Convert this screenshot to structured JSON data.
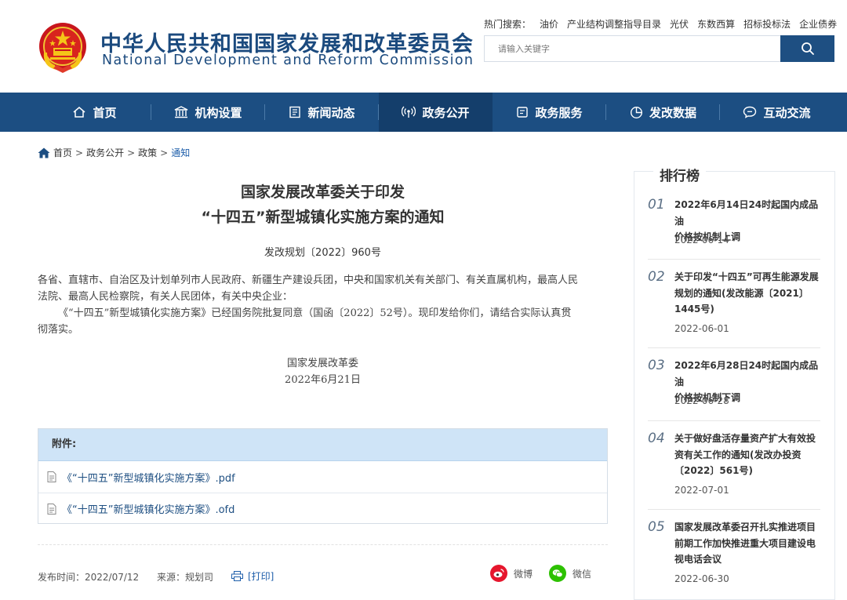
{
  "header": {
    "title_cn": "中华人民共和国国家发展和改革委员会",
    "title_en": "National Development and Reform Commission",
    "hot_label": "热门搜索：",
    "hot_items": [
      "油价",
      "产业结构调整指导目录",
      "光伏",
      "东数西算",
      "招标投标法",
      "企业债券"
    ],
    "search_placeholder": "请输入关键字"
  },
  "nav": {
    "items": [
      {
        "label": "首页",
        "icon": "home-icon"
      },
      {
        "label": "机构设置",
        "icon": "institution-icon"
      },
      {
        "label": "新闻动态",
        "icon": "news-icon"
      },
      {
        "label": "政务公开",
        "icon": "broadcast-icon",
        "active": true
      },
      {
        "label": "政务服务",
        "icon": "service-icon"
      },
      {
        "label": "发改数据",
        "icon": "pie-chart-icon"
      },
      {
        "label": "互动交流",
        "icon": "chat-icon"
      }
    ]
  },
  "breadcrumb": {
    "items": [
      "首页",
      "政务公开",
      "政策"
    ],
    "current": "通知",
    "separator": ">"
  },
  "article": {
    "title_line1": "国家发展改革委关于印发",
    "title_line2": "“十四五”新型城镇化实施方案的通知",
    "doc_no": "发改规划〔2022〕960号",
    "para1_line1": "各省、直辖市、自治区及计划单列市人民政府、新疆生产建设兵团，中央和国家机关有关部门、有关直属机构，最高人民",
    "para1_line2": "法院、最高人民检察院，有关人民团体，有关中央企业：",
    "para2_line1": "《“十四五”新型城镇化实施方案》已经国务院批复同意（国函〔2022〕52号）。现印发给你们，请结合实际认真贯",
    "para2_line2": "彻落实。",
    "signer": "国家发展改革委",
    "sign_date": "2022年6月21日"
  },
  "attachments": {
    "heading": "附件:",
    "files": [
      "《“十四五”新型城镇化实施方案》.pdf",
      "《“十四五”新型城镇化实施方案》.ofd"
    ]
  },
  "footer_meta": {
    "publish": "发布时间：2022/07/12",
    "source": "来源：规划司",
    "print": "[打印]",
    "share_weibo": "微博",
    "share_wechat": "微信"
  },
  "ranking": {
    "title": "排行榜",
    "items": [
      {
        "num": "01",
        "lines": [
          "2022年6月14日24时起国内成品油",
          "价格按机制上调"
        ],
        "date": "2022-06-14"
      },
      {
        "num": "02",
        "lines": [
          "关于印发“十四五”可再生能源发展",
          "规划的通知(发改能源〔2021〕",
          "1445号)"
        ],
        "date": "2022-06-01"
      },
      {
        "num": "03",
        "lines": [
          "2022年6月28日24时起国内成品油",
          "价格按机制下调"
        ],
        "date": "2022-06-28"
      },
      {
        "num": "04",
        "lines": [
          "关于做好盘活存量资产扩大有效投",
          "资有关工作的通知(发改办投资",
          "〔2022〕561号)"
        ],
        "date": "2022-07-01"
      },
      {
        "num": "05",
        "lines": [
          "国家发展改革委召开扎实推进项目",
          "前期工作加快推进重大项目建设电",
          "视电话会议"
        ],
        "date": "2022-06-30"
      }
    ]
  },
  "colors": {
    "brand": "#1c4e82",
    "nav_active": "#143e6b",
    "link": "#1e5eaa",
    "attach_head": "#cfe4f7",
    "weibo": "#e6162d",
    "wechat": "#2dc100"
  }
}
